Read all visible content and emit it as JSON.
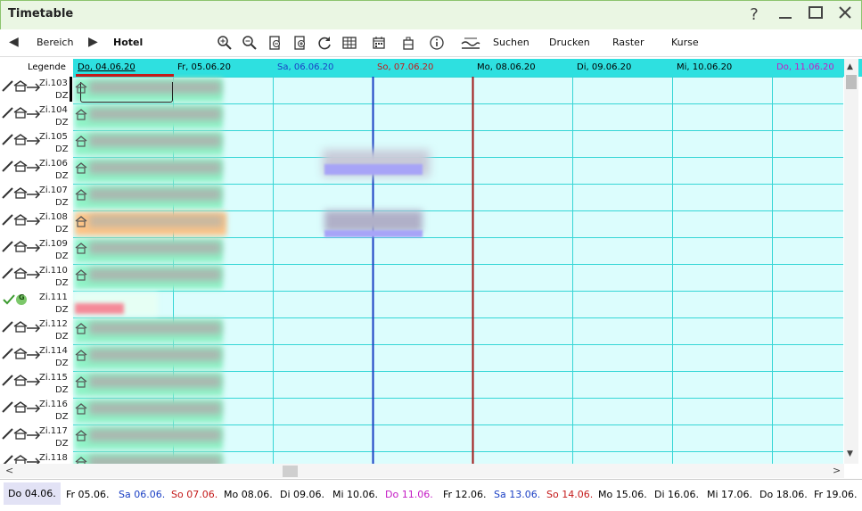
{
  "window": {
    "title": "Timetable",
    "help": "?",
    "minimize": "—",
    "maximize": "☐",
    "close": "✕"
  },
  "toolbar": {
    "prev": "◀",
    "bereich": "Bereich",
    "next": "▶",
    "hotel": "Hotel",
    "suchen": "Suchen",
    "drucken": "Drucken",
    "raster": "Raster",
    "kurse": "Kurse"
  },
  "legend": "Legende",
  "dates": [
    {
      "label": "Do, 04.06.20",
      "color": "#000000"
    },
    {
      "label": "Fr, 05.06.20",
      "color": "#000000"
    },
    {
      "label": "Sa, 06.06.20",
      "color": "#1a3fc4"
    },
    {
      "label": "So, 07.06.20",
      "color": "#c41a1a"
    },
    {
      "label": "Mo, 08.06.20",
      "color": "#000000"
    },
    {
      "label": "Di, 09.06.20",
      "color": "#000000"
    },
    {
      "label": "Mi, 10.06.20",
      "color": "#000000"
    },
    {
      "label": "Do, 11.06.20",
      "color": "#c41ac4"
    }
  ],
  "rooms": [
    {
      "room": "Zi.103",
      "type": "DZ"
    },
    {
      "room": "Zi.104",
      "type": "DZ"
    },
    {
      "room": "Zi.105",
      "type": "DZ"
    },
    {
      "room": "Zi.106",
      "type": "DZ"
    },
    {
      "room": "Zi.107",
      "type": "DZ"
    },
    {
      "room": "Zi.108",
      "type": "DZ"
    },
    {
      "room": "Zi.109",
      "type": "DZ"
    },
    {
      "room": "Zi.110",
      "type": "DZ"
    },
    {
      "room": "Zi.111",
      "type": "DZ",
      "status": "G"
    },
    {
      "room": "Zi.112",
      "type": "DZ"
    },
    {
      "room": "Zi.114",
      "type": "DZ"
    },
    {
      "room": "Zi.115",
      "type": "DZ"
    },
    {
      "room": "Zi.116",
      "type": "DZ"
    },
    {
      "room": "Zi.117",
      "type": "DZ"
    },
    {
      "room": "Zi.118",
      "type": ""
    }
  ],
  "bottom_days": [
    {
      "label": "Do 04.06.",
      "color": "#000000",
      "selected": true
    },
    {
      "label": "Fr 05.06.",
      "color": "#000000"
    },
    {
      "label": "Sa 06.06.",
      "color": "#1a3fc4"
    },
    {
      "label": "So 07.06.",
      "color": "#c41a1a"
    },
    {
      "label": "Mo 08.06.",
      "color": "#000000"
    },
    {
      "label": "Di 09.06.",
      "color": "#000000"
    },
    {
      "label": "Mi 10.06.",
      "color": "#000000"
    },
    {
      "label": "Do 11.06.",
      "color": "#c41ac4"
    },
    {
      "label": "Fr 12.06.",
      "color": "#000000"
    },
    {
      "label": "Sa 13.06.",
      "color": "#1a3fc4"
    },
    {
      "label": "So 14.06.",
      "color": "#c41a1a"
    },
    {
      "label": "Mo 15.06.",
      "color": "#000000"
    },
    {
      "label": "Di 16.06.",
      "color": "#000000"
    },
    {
      "label": "Mi 17.06.",
      "color": "#000000"
    },
    {
      "label": "Do 18.06.",
      "color": "#000000"
    },
    {
      "label": "Fr 19.06.",
      "color": "#000000"
    }
  ],
  "colors": {
    "accent_green": "#8cc46e",
    "grid_bg": "#dcfdfd",
    "grid_line": "#36d6d6",
    "booking_green": "#8ff2c6",
    "booking_orange": "#fdc487",
    "booking_red": "#f58a98",
    "booking_purple": "#a7a4f7",
    "today_bar": "#c41a1a",
    "saturday_line": "#1a3fc4",
    "sunday_line": "#a01818"
  }
}
